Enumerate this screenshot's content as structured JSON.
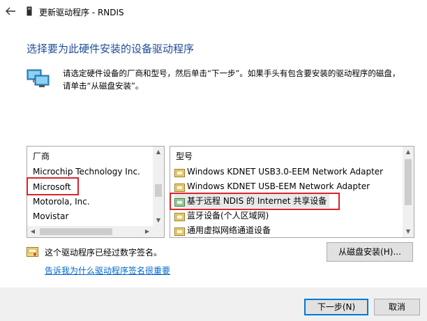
{
  "window": {
    "title": "更新驱动程序 - RNDIS",
    "back_icon": "back-arrow-icon"
  },
  "heading": "选择要为此硬件安装的设备驱动程序",
  "description_line1": "请选定硬件设备的厂商和型号，然后单击“下一步”。如果手头有包含要安装的驱动程序的磁盘，",
  "description_line2": "请单击“从磁盘安装”。",
  "manufacturer_list": {
    "header": "厂商",
    "items": [
      "Microchip Technology Inc.",
      "Microsoft",
      "Motorola, Inc.",
      "Movistar"
    ],
    "selected": "Microsoft"
  },
  "model_list": {
    "header": "型号",
    "items": [
      "Windows KDNET USB3.0-EEM Network Adapter",
      "Windows KDNET USB-EEM Network Adapter",
      "基于远程 NDIS 的 Internet 共享设备",
      "蓝牙设备(个人区域网)",
      "通用虚拟网络通道设备"
    ],
    "selected": "基于远程 NDIS 的 Internet 共享设备"
  },
  "signature_text": "这个驱动程序已经过数字签名。",
  "signature_link": "告诉我为什么驱动程序签名很重要",
  "buttons": {
    "have_disk": "从磁盘安装(H)...",
    "next": "下一步(N)",
    "cancel": "取消"
  },
  "colors": {
    "heading": "#1f4d99",
    "link": "#0066cc",
    "highlight_border": "#d9232a",
    "default_button_border": "#0078d7"
  }
}
